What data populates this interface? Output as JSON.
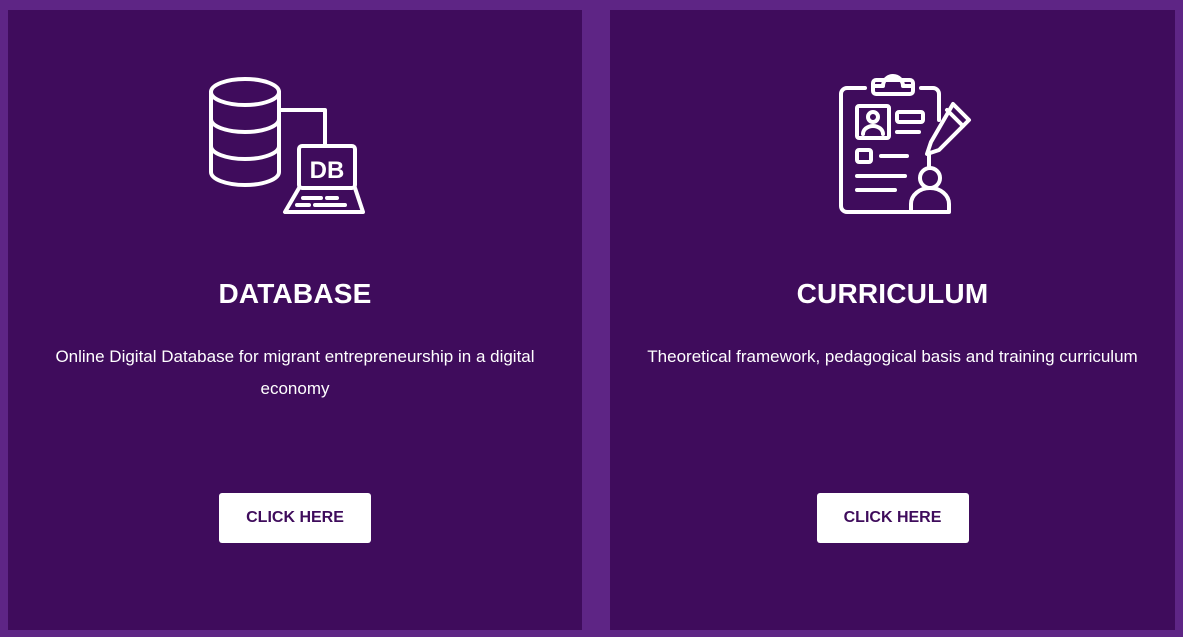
{
  "colors": {
    "page_background": "#5e2585",
    "card_background": "#3f0c5c",
    "button_background": "#ffffff",
    "button_text": "#3f0c5c",
    "text": "#ffffff"
  },
  "cards": [
    {
      "icon": "database-laptop-icon",
      "title": "DATABASE",
      "description": "Online Digital Database for migrant entrepreneurship in a digital economy",
      "button_label": "CLICK HERE",
      "icon_text": "DB"
    },
    {
      "icon": "clipboard-profile-pencil-icon",
      "title": "CURRICULUM",
      "description": "Theoretical framework, pedagogical basis and training curriculum",
      "button_label": "CLICK HERE"
    }
  ]
}
